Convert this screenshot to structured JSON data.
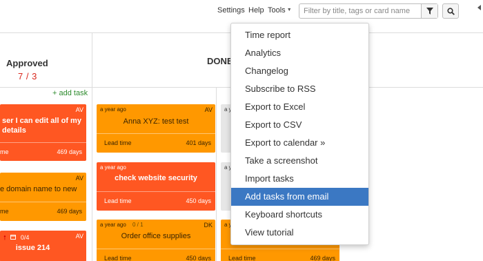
{
  "topbar": {
    "settings": "Settings",
    "help": "Help",
    "tools": "Tools",
    "search_placeholder": "Filter by title, tags or card name"
  },
  "columns": {
    "approved": {
      "title": "Approved",
      "count": "7 / 3",
      "add_task": "+ add task"
    },
    "done": {
      "title": "DONE"
    }
  },
  "cards": {
    "left1": {
      "title": "ser I can edit all of my details",
      "avatar": "AV",
      "lead_label": "me",
      "days": "469 days"
    },
    "left2": {
      "title": "e domain name to new",
      "avatar": "AV",
      "lead_label": "me",
      "days": "469 days"
    },
    "left3": {
      "title": "issue 214",
      "avatar": "AV",
      "meta": "0/4"
    },
    "mid1": {
      "age": "a year ago",
      "avatar": "AV",
      "title": "Anna XYZ: test test",
      "lead_label": "Lead time",
      "days": "401 days"
    },
    "mid2": {
      "age": "a year ago",
      "title": "check website security",
      "lead_label": "Lead time",
      "days": "450 days"
    },
    "mid3": {
      "age": "a year ago",
      "counter": "0 / 1",
      "avatar": "DK",
      "title": "Order office supplies",
      "lead_label": "Lead time",
      "days": "450 days"
    },
    "right1": {
      "age": "a y"
    },
    "right2": {
      "age": "a y"
    },
    "right3": {
      "age": "a y",
      "lead_label": "Lead time",
      "days": "469 days"
    }
  },
  "menu": {
    "items": [
      "Time report",
      "Analytics",
      "Changelog",
      "Subscribe to RSS",
      "Export to Excel",
      "Export to CSV",
      "Export to calendar »",
      "Take a screenshot",
      "Import tasks",
      "Add tasks from email",
      "Keyboard shortcuts",
      "View tutorial"
    ],
    "active_index": 9
  },
  "colors": {
    "orange_card": "#ff9800",
    "red_card": "#ff5722",
    "menu_active": "#3b78c3",
    "wip_count": "#d9261c",
    "add_task": "#2e8b2e"
  }
}
